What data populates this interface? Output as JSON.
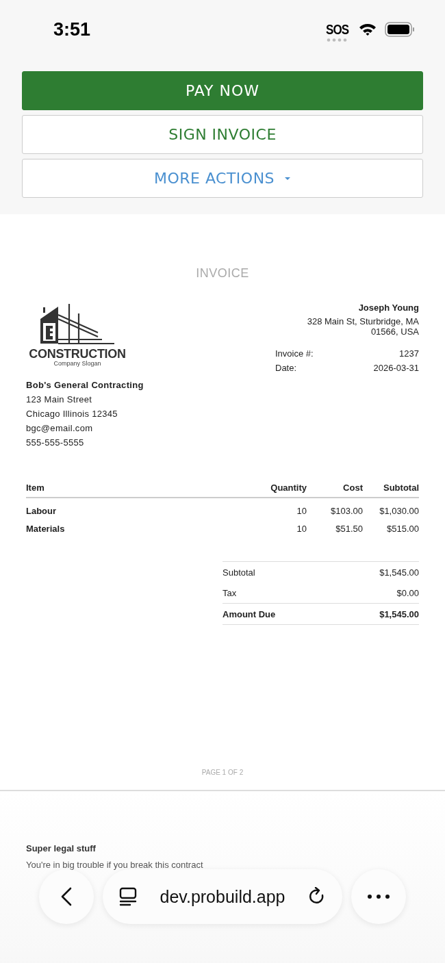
{
  "status_bar": {
    "time": "3:51",
    "sos": "SOS"
  },
  "actions": [
    {
      "kind": "primary",
      "label": "PAY NOW"
    },
    {
      "kind": "outline",
      "label": "SIGN INVOICE"
    },
    {
      "kind": "dropdown",
      "label": "MORE ACTIONS"
    }
  ],
  "invoice": {
    "title": "INVOICE",
    "logo": {
      "name": "CONSTRUCTION",
      "slogan": "Company Slogan"
    },
    "client": {
      "name": "Joseph Young",
      "address": [
        "328 Main St, Sturbridge, MA",
        "01566, USA"
      ]
    },
    "meta": [
      {
        "label": "Invoice #:",
        "value": "1237"
      },
      {
        "label": "Date:",
        "value": "2026-03-31"
      }
    ],
    "company": {
      "name": "Bob's General Contracting",
      "lines": [
        "123 Main Street",
        "Chicago Illinois 12345",
        "bgc@email.com",
        "555-555-5555"
      ]
    },
    "columns": [
      "Item",
      "Quantity",
      "Cost",
      "Subtotal"
    ],
    "rows": [
      [
        "Labour",
        "10",
        "$103.00",
        "$1,030.00"
      ],
      [
        "Materials",
        "10",
        "$51.50",
        "$515.00"
      ]
    ],
    "totals": [
      {
        "label": "Subtotal",
        "value": "$1,545.00",
        "bold": false
      },
      {
        "label": "Tax",
        "value": "$0.00",
        "bold": false
      },
      {
        "label": "Amount Due",
        "value": "$1,545.00",
        "bold": true
      }
    ],
    "page": "PAGE 1 OF 2"
  },
  "page2": {
    "heading": "Super legal stuff",
    "text": "You're in big trouble if you break this contract"
  },
  "browser": {
    "url": "dev.probuild.app"
  }
}
